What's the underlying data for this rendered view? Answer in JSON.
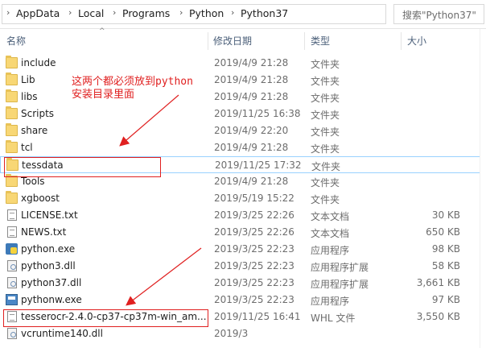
{
  "address": {
    "crumbs": [
      "AppData",
      "Local",
      "Programs",
      "Python",
      "Python37"
    ],
    "search_placeholder": "搜索\"Python37\""
  },
  "columns": {
    "name": "名称",
    "date": "修改日期",
    "type": "类型",
    "size": "大小"
  },
  "files": [
    {
      "name": "include",
      "date": "2019/4/9 21:28",
      "type": "文件夹",
      "size": "",
      "icon": "folder-icon"
    },
    {
      "name": "Lib",
      "date": "2019/4/9 21:28",
      "type": "文件夹",
      "size": "",
      "icon": "folder-icon"
    },
    {
      "name": "libs",
      "date": "2019/4/9 21:28",
      "type": "文件夹",
      "size": "",
      "icon": "folder-icon"
    },
    {
      "name": "Scripts",
      "date": "2019/11/25 16:38",
      "type": "文件夹",
      "size": "",
      "icon": "folder-icon"
    },
    {
      "name": "share",
      "date": "2019/4/9 22:20",
      "type": "文件夹",
      "size": "",
      "icon": "folder-icon"
    },
    {
      "name": "tcl",
      "date": "2019/4/9 21:28",
      "type": "文件夹",
      "size": "",
      "icon": "folder-icon"
    },
    {
      "name": "tessdata",
      "date": "2019/11/25 17:32",
      "type": "文件夹",
      "size": "",
      "icon": "folder-icon"
    },
    {
      "name": "Tools",
      "date": "2019/4/9 21:28",
      "type": "文件夹",
      "size": "",
      "icon": "folder-icon"
    },
    {
      "name": "xgboost",
      "date": "2019/5/19 15:22",
      "type": "文件夹",
      "size": "",
      "icon": "folder-icon"
    },
    {
      "name": "LICENSE.txt",
      "date": "2019/3/25 22:26",
      "type": "文本文档",
      "size": "30 KB",
      "icon": "text-file-icon"
    },
    {
      "name": "NEWS.txt",
      "date": "2019/3/25 22:26",
      "type": "文本文档",
      "size": "650 KB",
      "icon": "text-file-icon"
    },
    {
      "name": "python.exe",
      "date": "2019/3/25 22:23",
      "type": "应用程序",
      "size": "98 KB",
      "icon": "python-exe-icon"
    },
    {
      "name": "python3.dll",
      "date": "2019/3/25 22:23",
      "type": "应用程序扩展",
      "size": "58 KB",
      "icon": "dll-icon"
    },
    {
      "name": "python37.dll",
      "date": "2019/3/25 22:23",
      "type": "应用程序扩展",
      "size": "3,661 KB",
      "icon": "dll-icon"
    },
    {
      "name": "pythonw.exe",
      "date": "2019/3/25 22:23",
      "type": "应用程序",
      "size": "97 KB",
      "icon": "window-exe-icon"
    },
    {
      "name": "tesserocr-2.4.0-cp37-cp37m-win_am...",
      "date": "2019/11/25 16:41",
      "type": "WHL 文件",
      "size": "3,550 KB",
      "icon": "whl-file-icon"
    },
    {
      "name": "vcruntime140.dll",
      "date": "2019/3",
      "type": "",
      "size": "",
      "icon": "dll-icon"
    }
  ],
  "annotation": {
    "line1": "这两个都必须放到python",
    "line2": "安装目录里面",
    "color": "#e02020"
  }
}
